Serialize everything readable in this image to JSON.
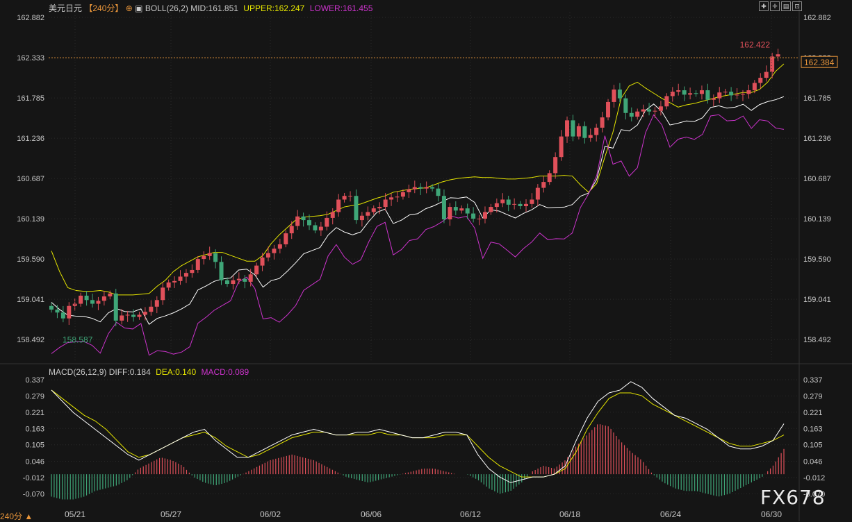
{
  "header": {
    "symbol": "美元日元",
    "period": "【240分】",
    "boll": {
      "label": "BOLL(26,2)",
      "mid": "MID:161.851",
      "upper": "UPPER:162.247",
      "lower": "LOWER:161.455"
    },
    "macd": {
      "label": "MACD(26,12,9)",
      "diff": "DIFF:0.184",
      "dea": "DEA:0.140",
      "macd": "MACD:0.089"
    }
  },
  "footer": {
    "period_button": "240分 ▲"
  },
  "watermark": "FX678",
  "colors": {
    "bg": "#151515",
    "up": "#e0505a",
    "down": "#3fa678",
    "upper": "#e6e600",
    "mid": "#ffffff",
    "lower": "#cc33cc",
    "dea": "#e6e600",
    "diff": "#ffffff",
    "grid": "#2a2a2a",
    "price_tag": "#e8953a"
  },
  "chart_data": [
    {
      "type": "candlestick",
      "title": "美元日元 240分",
      "y_ticks": [
        "162.882",
        "162.333",
        "161.785",
        "161.236",
        "160.687",
        "160.139",
        "159.590",
        "159.041",
        "158.492"
      ],
      "ylim": [
        158.2,
        162.95
      ],
      "x_ticks": [
        "05/21",
        "05/27",
        "06/02",
        "06/06",
        "06/12",
        "06/18",
        "06/24",
        "06/30"
      ],
      "high_label": "162.422",
      "low_label": "158.587",
      "current_price": "162.384",
      "close": [
        158.9,
        158.86,
        158.78,
        158.95,
        158.98,
        159.09,
        159.03,
        158.98,
        159.02,
        159.08,
        159.12,
        158.75,
        158.82,
        158.83,
        158.8,
        158.83,
        158.87,
        158.94,
        159.03,
        159.2,
        159.27,
        159.29,
        159.35,
        159.4,
        159.44,
        159.59,
        159.63,
        159.67,
        159.55,
        159.3,
        159.25,
        159.3,
        159.32,
        159.28,
        159.38,
        159.5,
        159.61,
        159.67,
        159.73,
        159.79,
        159.94,
        160.04,
        160.17,
        160.12,
        160.05,
        159.98,
        160.03,
        160.15,
        160.23,
        160.4,
        160.45,
        160.45,
        160.12,
        160.18,
        160.23,
        160.28,
        160.3,
        160.4,
        160.43,
        160.44,
        160.5,
        160.54,
        160.57,
        160.55,
        160.57,
        160.55,
        160.45,
        160.13,
        160.3,
        160.25,
        160.28,
        160.21,
        160.14,
        160.14,
        160.23,
        160.3,
        160.35,
        160.4,
        160.33,
        160.34,
        160.31,
        160.34,
        160.4,
        160.56,
        160.64,
        160.76,
        160.98,
        161.26,
        161.48,
        161.26,
        161.4,
        161.24,
        161.28,
        161.38,
        161.52,
        161.73,
        161.9,
        161.78,
        161.58,
        161.53,
        161.6,
        161.63,
        161.6,
        161.61,
        161.67,
        161.81,
        161.87,
        161.89,
        161.83,
        161.85,
        161.84,
        161.89,
        161.76,
        161.78,
        161.86,
        161.87,
        161.82,
        161.83,
        161.84,
        161.89,
        161.99,
        162.06,
        162.14,
        162.35,
        162.38
      ],
      "open": [
        158.95,
        158.9,
        158.86,
        158.78,
        158.95,
        158.98,
        159.09,
        159.03,
        158.98,
        159.02,
        159.08,
        159.12,
        158.75,
        158.82,
        158.83,
        158.8,
        158.83,
        158.87,
        158.94,
        159.03,
        159.2,
        159.27,
        159.29,
        159.35,
        159.4,
        159.44,
        159.59,
        159.63,
        159.67,
        159.55,
        159.3,
        159.25,
        159.3,
        159.32,
        159.28,
        159.38,
        159.5,
        159.61,
        159.67,
        159.73,
        159.79,
        159.94,
        160.04,
        160.17,
        160.12,
        160.05,
        159.98,
        160.03,
        160.15,
        160.23,
        160.4,
        160.45,
        160.45,
        160.12,
        160.18,
        160.23,
        160.28,
        160.3,
        160.4,
        160.43,
        160.44,
        160.5,
        160.54,
        160.57,
        160.55,
        160.57,
        160.55,
        160.45,
        160.13,
        160.3,
        160.25,
        160.28,
        160.21,
        160.14,
        160.14,
        160.23,
        160.3,
        160.35,
        160.4,
        160.33,
        160.34,
        160.31,
        160.34,
        160.4,
        160.56,
        160.64,
        160.76,
        160.98,
        161.26,
        161.48,
        161.26,
        161.4,
        161.24,
        161.28,
        161.38,
        161.52,
        161.73,
        161.9,
        161.78,
        161.58,
        161.53,
        161.6,
        161.63,
        161.6,
        161.61,
        161.67,
        161.81,
        161.87,
        161.89,
        161.83,
        161.85,
        161.84,
        161.89,
        161.76,
        161.78,
        161.86,
        161.87,
        161.82,
        161.83,
        161.84,
        161.89,
        161.99,
        162.06,
        162.14,
        162.35
      ],
      "upper": [
        159.7,
        159.42,
        159.2,
        159.16,
        159.15,
        159.15,
        159.16,
        159.14,
        159.1,
        159.1,
        159.1,
        159.11,
        159.12,
        159.22,
        159.3,
        159.42,
        159.5,
        159.56,
        159.62,
        159.65,
        159.68,
        159.68,
        159.64,
        159.6,
        159.56,
        159.56,
        159.64,
        159.8,
        159.92,
        160.02,
        160.12,
        160.16,
        160.17,
        160.18,
        160.2,
        160.25,
        160.3,
        160.32,
        160.34,
        160.38,
        160.42,
        160.45,
        160.5,
        160.52,
        160.54,
        160.55,
        160.56,
        160.6,
        160.64,
        160.67,
        160.69,
        160.7,
        160.71,
        160.7,
        160.7,
        160.69,
        160.68,
        160.68,
        160.69,
        160.7,
        160.72,
        160.72,
        160.72,
        160.73,
        160.72,
        160.6,
        160.5,
        160.62,
        160.98,
        161.32,
        161.78,
        161.95,
        162.0,
        161.92,
        161.85,
        161.78,
        161.72,
        161.66,
        161.69,
        161.71,
        161.74,
        161.77,
        161.8,
        161.82,
        161.84,
        161.86,
        161.86,
        161.9,
        162.0,
        162.15,
        162.25
      ]
    },
    {
      "type": "macd",
      "y_ticks": [
        "0.337",
        "0.279",
        "0.221",
        "0.163",
        "0.105",
        "0.046",
        "-0.012",
        "-0.070"
      ],
      "ylim": [
        -0.116,
        0.337
      ],
      "diff": [
        0.3,
        0.26,
        0.22,
        0.19,
        0.16,
        0.13,
        0.1,
        0.07,
        0.05,
        0.07,
        0.09,
        0.11,
        0.13,
        0.15,
        0.16,
        0.12,
        0.09,
        0.06,
        0.06,
        0.08,
        0.1,
        0.12,
        0.14,
        0.15,
        0.16,
        0.15,
        0.14,
        0.14,
        0.15,
        0.15,
        0.16,
        0.15,
        0.14,
        0.13,
        0.13,
        0.14,
        0.15,
        0.15,
        0.14,
        0.07,
        0.02,
        -0.01,
        -0.03,
        -0.02,
        -0.01,
        -0.01,
        0.0,
        0.03,
        0.12,
        0.2,
        0.26,
        0.29,
        0.3,
        0.33,
        0.31,
        0.27,
        0.24,
        0.21,
        0.2,
        0.18,
        0.16,
        0.13,
        0.1,
        0.09,
        0.09,
        0.1,
        0.12,
        0.18
      ],
      "dea": [
        0.3,
        0.27,
        0.24,
        0.21,
        0.19,
        0.16,
        0.12,
        0.08,
        0.06,
        0.07,
        0.09,
        0.11,
        0.13,
        0.14,
        0.15,
        0.13,
        0.1,
        0.08,
        0.06,
        0.07,
        0.09,
        0.11,
        0.13,
        0.14,
        0.15,
        0.15,
        0.14,
        0.14,
        0.14,
        0.14,
        0.15,
        0.14,
        0.14,
        0.13,
        0.13,
        0.13,
        0.14,
        0.14,
        0.14,
        0.1,
        0.06,
        0.03,
        0.01,
        -0.01,
        -0.01,
        -0.01,
        0.0,
        0.02,
        0.08,
        0.16,
        0.22,
        0.27,
        0.29,
        0.29,
        0.28,
        0.25,
        0.23,
        0.21,
        0.19,
        0.17,
        0.15,
        0.13,
        0.11,
        0.1,
        0.1,
        0.11,
        0.12,
        0.14
      ],
      "macd": [
        -0.08,
        -0.09,
        -0.09,
        -0.08,
        -0.06,
        -0.05,
        -0.04,
        -0.02,
        0.02,
        0.04,
        0.06,
        0.05,
        0.03,
        -0.01,
        -0.03,
        -0.04,
        -0.03,
        -0.01,
        0.01,
        0.03,
        0.05,
        0.06,
        0.07,
        0.06,
        0.05,
        0.03,
        0.01,
        -0.01,
        -0.02,
        -0.03,
        -0.02,
        -0.01,
        0.0,
        0.01,
        0.02,
        0.02,
        0.01,
        0.0,
        0.0,
        -0.02,
        -0.05,
        -0.07,
        -0.06,
        -0.03,
        0.01,
        0.03,
        0.02,
        0.05,
        0.1,
        0.14,
        0.18,
        0.17,
        0.12,
        0.08,
        0.05,
        0.0,
        -0.03,
        -0.05,
        -0.06,
        -0.06,
        -0.07,
        -0.08,
        -0.07,
        -0.05,
        -0.03,
        -0.01,
        0.03,
        0.09
      ]
    }
  ]
}
